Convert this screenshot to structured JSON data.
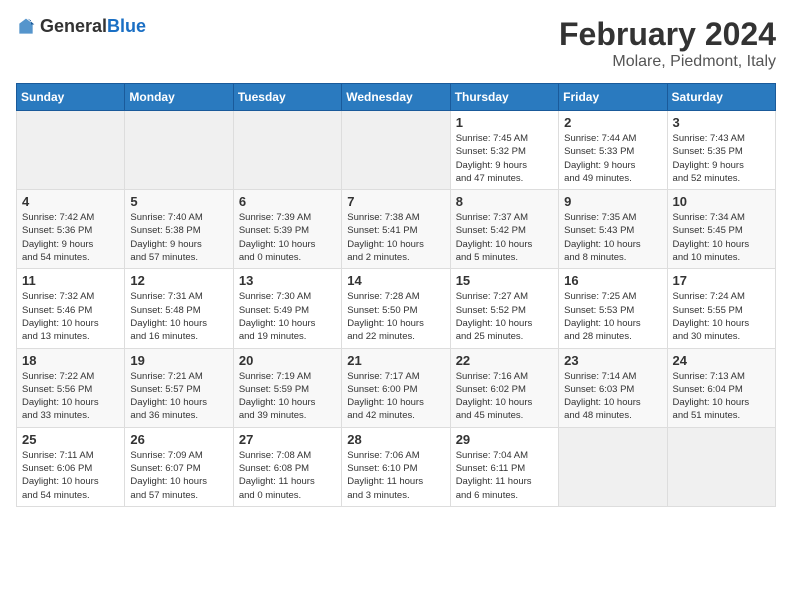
{
  "logo": {
    "general": "General",
    "blue": "Blue"
  },
  "title": "February 2024",
  "location": "Molare, Piedmont, Italy",
  "days_of_week": [
    "Sunday",
    "Monday",
    "Tuesday",
    "Wednesday",
    "Thursday",
    "Friday",
    "Saturday"
  ],
  "weeks": [
    [
      {
        "day": "",
        "info": ""
      },
      {
        "day": "",
        "info": ""
      },
      {
        "day": "",
        "info": ""
      },
      {
        "day": "",
        "info": ""
      },
      {
        "day": "1",
        "info": "Sunrise: 7:45 AM\nSunset: 5:32 PM\nDaylight: 9 hours\nand 47 minutes."
      },
      {
        "day": "2",
        "info": "Sunrise: 7:44 AM\nSunset: 5:33 PM\nDaylight: 9 hours\nand 49 minutes."
      },
      {
        "day": "3",
        "info": "Sunrise: 7:43 AM\nSunset: 5:35 PM\nDaylight: 9 hours\nand 52 minutes."
      }
    ],
    [
      {
        "day": "4",
        "info": "Sunrise: 7:42 AM\nSunset: 5:36 PM\nDaylight: 9 hours\nand 54 minutes."
      },
      {
        "day": "5",
        "info": "Sunrise: 7:40 AM\nSunset: 5:38 PM\nDaylight: 9 hours\nand 57 minutes."
      },
      {
        "day": "6",
        "info": "Sunrise: 7:39 AM\nSunset: 5:39 PM\nDaylight: 10 hours\nand 0 minutes."
      },
      {
        "day": "7",
        "info": "Sunrise: 7:38 AM\nSunset: 5:41 PM\nDaylight: 10 hours\nand 2 minutes."
      },
      {
        "day": "8",
        "info": "Sunrise: 7:37 AM\nSunset: 5:42 PM\nDaylight: 10 hours\nand 5 minutes."
      },
      {
        "day": "9",
        "info": "Sunrise: 7:35 AM\nSunset: 5:43 PM\nDaylight: 10 hours\nand 8 minutes."
      },
      {
        "day": "10",
        "info": "Sunrise: 7:34 AM\nSunset: 5:45 PM\nDaylight: 10 hours\nand 10 minutes."
      }
    ],
    [
      {
        "day": "11",
        "info": "Sunrise: 7:32 AM\nSunset: 5:46 PM\nDaylight: 10 hours\nand 13 minutes."
      },
      {
        "day": "12",
        "info": "Sunrise: 7:31 AM\nSunset: 5:48 PM\nDaylight: 10 hours\nand 16 minutes."
      },
      {
        "day": "13",
        "info": "Sunrise: 7:30 AM\nSunset: 5:49 PM\nDaylight: 10 hours\nand 19 minutes."
      },
      {
        "day": "14",
        "info": "Sunrise: 7:28 AM\nSunset: 5:50 PM\nDaylight: 10 hours\nand 22 minutes."
      },
      {
        "day": "15",
        "info": "Sunrise: 7:27 AM\nSunset: 5:52 PM\nDaylight: 10 hours\nand 25 minutes."
      },
      {
        "day": "16",
        "info": "Sunrise: 7:25 AM\nSunset: 5:53 PM\nDaylight: 10 hours\nand 28 minutes."
      },
      {
        "day": "17",
        "info": "Sunrise: 7:24 AM\nSunset: 5:55 PM\nDaylight: 10 hours\nand 30 minutes."
      }
    ],
    [
      {
        "day": "18",
        "info": "Sunrise: 7:22 AM\nSunset: 5:56 PM\nDaylight: 10 hours\nand 33 minutes."
      },
      {
        "day": "19",
        "info": "Sunrise: 7:21 AM\nSunset: 5:57 PM\nDaylight: 10 hours\nand 36 minutes."
      },
      {
        "day": "20",
        "info": "Sunrise: 7:19 AM\nSunset: 5:59 PM\nDaylight: 10 hours\nand 39 minutes."
      },
      {
        "day": "21",
        "info": "Sunrise: 7:17 AM\nSunset: 6:00 PM\nDaylight: 10 hours\nand 42 minutes."
      },
      {
        "day": "22",
        "info": "Sunrise: 7:16 AM\nSunset: 6:02 PM\nDaylight: 10 hours\nand 45 minutes."
      },
      {
        "day": "23",
        "info": "Sunrise: 7:14 AM\nSunset: 6:03 PM\nDaylight: 10 hours\nand 48 minutes."
      },
      {
        "day": "24",
        "info": "Sunrise: 7:13 AM\nSunset: 6:04 PM\nDaylight: 10 hours\nand 51 minutes."
      }
    ],
    [
      {
        "day": "25",
        "info": "Sunrise: 7:11 AM\nSunset: 6:06 PM\nDaylight: 10 hours\nand 54 minutes."
      },
      {
        "day": "26",
        "info": "Sunrise: 7:09 AM\nSunset: 6:07 PM\nDaylight: 10 hours\nand 57 minutes."
      },
      {
        "day": "27",
        "info": "Sunrise: 7:08 AM\nSunset: 6:08 PM\nDaylight: 11 hours\nand 0 minutes."
      },
      {
        "day": "28",
        "info": "Sunrise: 7:06 AM\nSunset: 6:10 PM\nDaylight: 11 hours\nand 3 minutes."
      },
      {
        "day": "29",
        "info": "Sunrise: 7:04 AM\nSunset: 6:11 PM\nDaylight: 11 hours\nand 6 minutes."
      },
      {
        "day": "",
        "info": ""
      },
      {
        "day": "",
        "info": ""
      }
    ]
  ]
}
